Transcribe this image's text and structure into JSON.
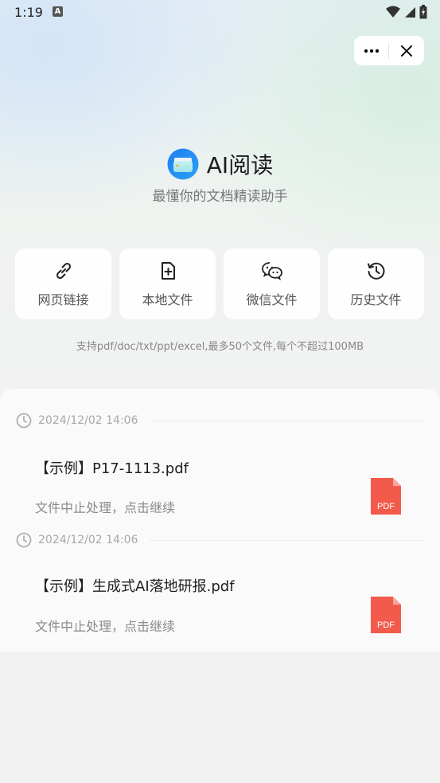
{
  "status_bar": {
    "time": "1:19",
    "notification_glyph": "A"
  },
  "capsule": {
    "more_icon": "more-icon",
    "close_icon": "close-icon"
  },
  "header": {
    "title": "AI阅读",
    "subtitle": "最懂你的文档精读助手",
    "logo_icon": "folder-logo-icon"
  },
  "actions": [
    {
      "label": "网页链接",
      "icon": "link-icon"
    },
    {
      "label": "本地文件",
      "icon": "file-add-icon"
    },
    {
      "label": "微信文件",
      "icon": "wechat-icon"
    },
    {
      "label": "历史文件",
      "icon": "history-icon"
    }
  ],
  "hint": "支持pdf/doc/txt/ppt/excel,最多50个文件,每个不超过100MB",
  "history": [
    {
      "date": "2024/12/02 14:06",
      "file_name": "【示例】P17-1113.pdf",
      "status": "文件中止处理，点击继续",
      "badge": "PDF"
    },
    {
      "date": "2024/12/02 14:06",
      "file_name": "【示例】生成式AI落地研报.pdf",
      "status": "文件中止处理，点击继续",
      "badge": "PDF"
    }
  ],
  "colors": {
    "pdf_red": "#f25b4c",
    "logo_blue": "#2b8cf0"
  }
}
